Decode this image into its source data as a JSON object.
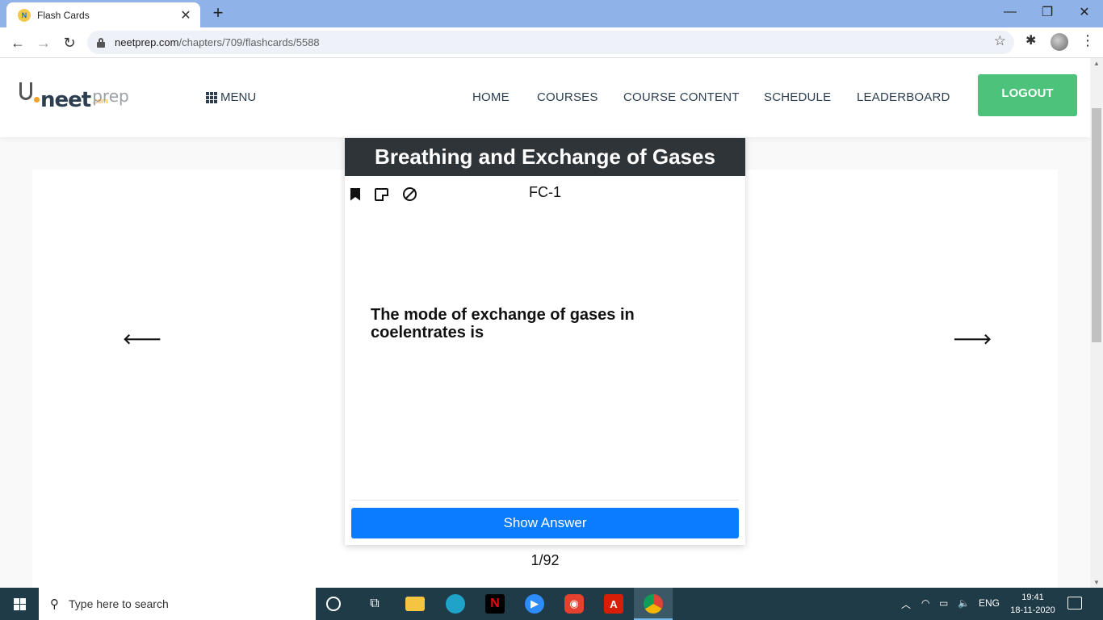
{
  "browser": {
    "tab_title": "Flash Cards",
    "tab_favicon_letter": "N",
    "new_tab_symbol": "+",
    "url_host": "neetprep.com",
    "url_path": "/chapters/709/flashcards/5588",
    "window_controls": [
      "—",
      "❐",
      "✕"
    ]
  },
  "site": {
    "logo": {
      "neet": "neet",
      "prep": "prep",
      "com": ".com"
    },
    "menu_label": "MENU",
    "nav": [
      "HOME",
      "COURSES",
      "COURSE CONTENT",
      "SCHEDULE",
      "LEADERBOARD"
    ],
    "logout_label": "LOGOUT"
  },
  "flashcard": {
    "chapter_title": "Breathing and Exchange of Gases",
    "card_id": "FC-1",
    "question": "The mode of exchange of gases in coelentrates is",
    "show_answer_label": "Show Answer",
    "counter": "1/92",
    "prev_arrow": "🡐",
    "next_arrow": "🡒"
  },
  "taskbar": {
    "search_placeholder": "Type here to search",
    "language": "ENG",
    "time": "19:41",
    "date": "18-11-2020",
    "icons": [
      "cortana-icon",
      "task-view-icon",
      "file-explorer-icon",
      "edge-icon",
      "netflix-icon",
      "zoom-icon",
      "app-icon",
      "acrobat-icon",
      "chrome-icon"
    ]
  },
  "colors": {
    "tabbar": "#8fb2e8",
    "card_title_bar": "#2f3439",
    "show_answer": "#0a7cff",
    "logout": "#4cc27a",
    "taskbar": "#1f3b47"
  }
}
